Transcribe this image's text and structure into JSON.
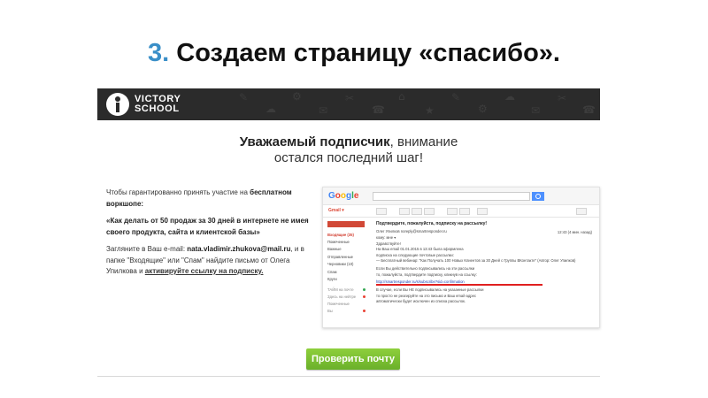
{
  "slide": {
    "number": "3.",
    "title": "Создаем страницу «спасибо»."
  },
  "header": {
    "logo_line1": "VICTORY",
    "logo_line2": "SCHOOL"
  },
  "headline": {
    "bold": "Уважаемый подписчик",
    "rest": ", внимание",
    "line2": "остался последний шаг!"
  },
  "text": {
    "p1_plain": "Чтобы гарантированно принять участие на ",
    "p1_bold": "бесплатном воркшопе:",
    "p2": "«Как делать от 50 продаж за 30 дней в интернете не имея своего продукта, сайта и клиентской базы»",
    "p3_a": "Загляните в Ваш e-mail: ",
    "p3_email": "nata.vladimir.zhukova@mail.ru",
    "p3_b": ", и в папке \"Входящие\" или \"Спам\" найдите письмо от Олега Упилкова и ",
    "p3_link": "активируйте ссылку на подписку."
  },
  "gmail": {
    "logo": "Google",
    "app": "Gmail ▾",
    "subject": "Подтвердите, пожалуйста, подписку на рассылку!",
    "folders": [
      "Входящие (35)",
      "Помеченные",
      "Важные",
      "Отправленные",
      "Черновики (10)",
      "Спам",
      "Круги"
    ],
    "chat": [
      "ТАЙМ на почте",
      "Здесь на нейтре",
      "Помеченные",
      "Вы"
    ],
    "date": "12:43 (4 мин. назад)",
    "body": [
      "Олег Упилков  noreply@smartresponder.ru",
      "кому: мне ▾",
      "Здравствуйте!",
      "На Ваш email 01.01.2015 в 13:43 была оформлена",
      "подписка на следующие почтовые рассылки:",
      "— Бесплатный вебинар: \"Как Получать 100 Новых Клиентов за 30 Дней с Группы ВКонтакте\" (Автор: Олег Упилков)",
      "Если Вы действительно подписывались на эти рассылки",
      "то, пожалуйста, подтвердите подписку, кликнув на ссылку:",
      "http://smartresponder.ru/s/subscribe?sid=confirmation",
      "В случае, если Вы НЕ подписывались на указанные рассылки",
      "то просто не реагируйте на это письмо и Ваш email-адрес",
      "автоматически будет исключен из списка рассылок."
    ]
  },
  "button": {
    "label": "Проверить почту"
  },
  "colors": {
    "accent": "#3a8fc8",
    "header_bg": "#2b2b2b",
    "button": "#7abf33",
    "gmail_red": "#dd4b39"
  }
}
